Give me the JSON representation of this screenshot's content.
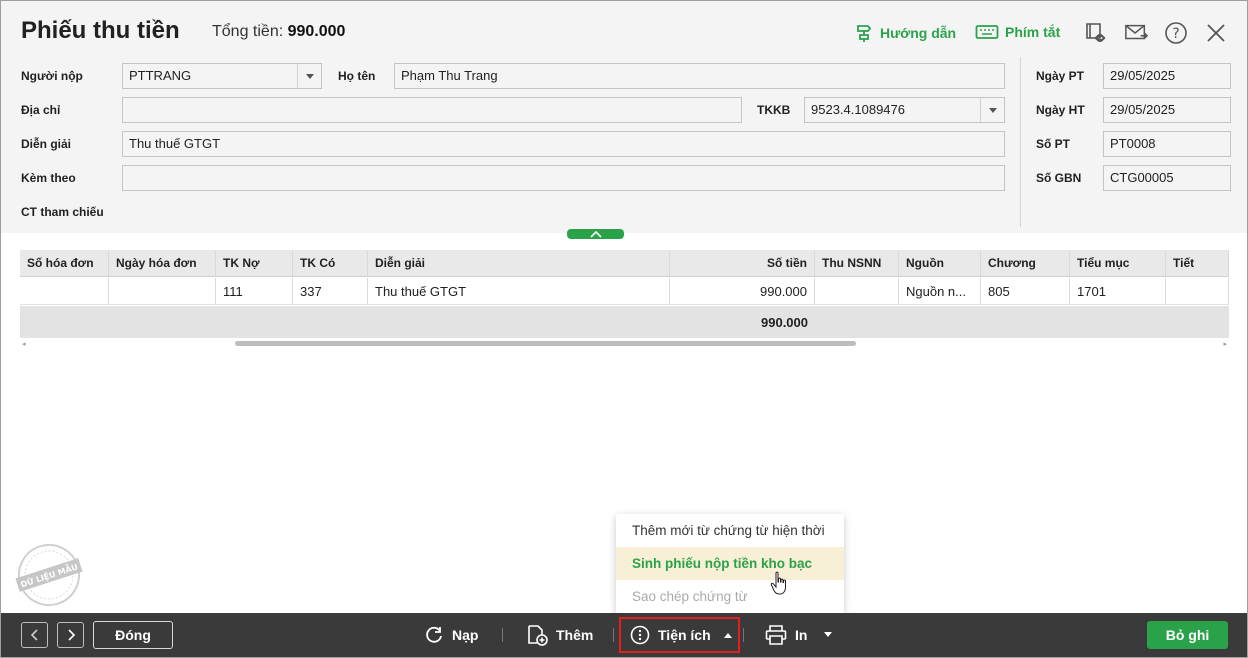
{
  "header": {
    "title": "Phiếu thu tiền",
    "total_label": "Tổng tiền:",
    "total_value": "990.000",
    "guide_label": "Hướng dẫn",
    "shortcut_label": "Phím tắt"
  },
  "form": {
    "payer_label": "Người nộp",
    "payer_value": "PTTRANG",
    "name_label": "Họ tên",
    "name_value": "Phạm Thu Trang",
    "address_label": "Địa chỉ",
    "address_value": "",
    "tkkb_label": "TKKB",
    "tkkb_value": "9523.4.1089476",
    "desc_label": "Diễn giải",
    "desc_value": "Thu thuế GTGT",
    "attach_label": "Kèm theo",
    "attach_value": "",
    "ref_label": "CT tham chiếu",
    "date_pt_label": "Ngày PT",
    "date_pt_value": "29/05/2025",
    "date_ht_label": "Ngày HT",
    "date_ht_value": "29/05/2025",
    "so_pt_label": "Số PT",
    "so_pt_value": "PT0008",
    "so_gbn_label": "Số GBN",
    "so_gbn_value": "CTG00005"
  },
  "grid": {
    "columns": [
      "Số hóa đơn",
      "Ngày hóa đơn",
      "TK Nợ",
      "TK Có",
      "Diễn giải",
      "Số tiền",
      "Thu NSNN",
      "Nguồn",
      "Chương",
      "Tiểu mục",
      "Tiết"
    ],
    "rows": [
      [
        "",
        "",
        "111",
        "337",
        "Thu thuế GTGT",
        "990.000",
        "",
        "Nguồn n...",
        "805",
        "1701",
        ""
      ]
    ],
    "total_amount": "990.000"
  },
  "menu": {
    "items": [
      "Thêm mới từ chứng từ hiện thời",
      "Sinh phiếu nộp tiền kho bạc",
      "Sao chép chứng từ"
    ]
  },
  "footer": {
    "close_label": "Đóng",
    "reload_label": "Nạp",
    "add_label": "Thêm",
    "utility_label": "Tiện ích",
    "print_label": "In",
    "save_label": "Bỏ ghi"
  },
  "stamp": {
    "text": "DỮ LIỆU MẪU"
  },
  "colors": {
    "accent": "#2aa24a",
    "highlight_bg": "#f7f0d6",
    "footer_bg": "#3a3a3a",
    "focus_border": "#e02020"
  },
  "icons": [
    "guide-icon",
    "keyboard-icon",
    "book-view-icon",
    "mail-icon",
    "help-icon",
    "close-icon",
    "chevron-up-icon",
    "prev-icon",
    "next-icon",
    "reload-icon",
    "add-doc-icon",
    "utility-icon",
    "printer-icon",
    "hand-cursor-icon"
  ]
}
